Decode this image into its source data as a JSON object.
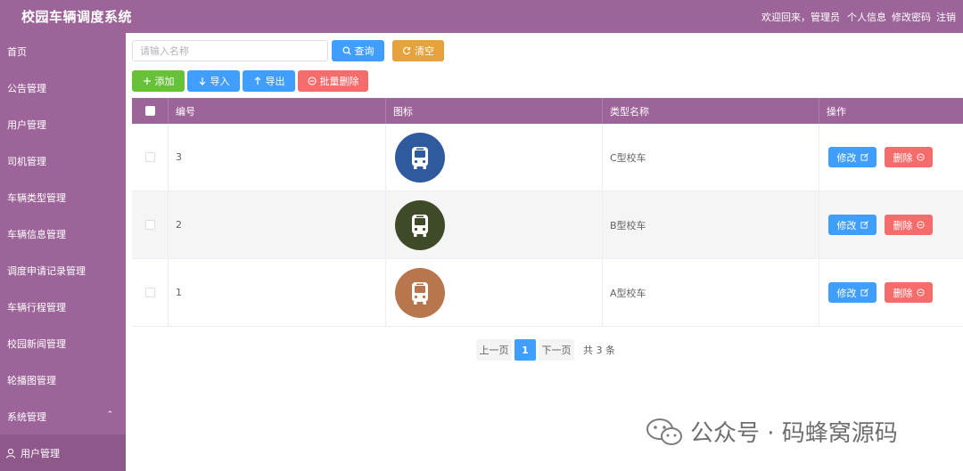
{
  "header": {
    "title": "校园车辆调度系统",
    "welcome": "欢迎回来，管理员",
    "links": [
      "个人信息",
      "修改密码",
      "注销"
    ]
  },
  "sidebar": {
    "items": [
      "首页",
      "公告管理",
      "用户管理",
      "司机管理",
      "车辆类型管理",
      "车辆信息管理",
      "调度申请记录管理",
      "车辆行程管理",
      "校园新闻管理",
      "轮播图管理",
      "系统管理"
    ],
    "system_chevron": "⌃",
    "sub_items": [
      "用户管理"
    ]
  },
  "toolbar": {
    "search_placeholder": "请输入名称",
    "query_label": "查询",
    "clear_label": "清空",
    "add_label": "添加",
    "import_label": "导入",
    "export_label": "导出",
    "bulk_delete_label": "批量删除"
  },
  "table": {
    "headers": [
      "编号",
      "图标",
      "类型名称",
      "操作"
    ],
    "rows": [
      {
        "id": "3",
        "type_name": "C型校车",
        "icon_color": "#2f5a9e",
        "edit": "修改",
        "delete": "删除"
      },
      {
        "id": "2",
        "type_name": "B型校车",
        "icon_color": "#3f4a28",
        "edit": "修改",
        "delete": "删除"
      },
      {
        "id": "1",
        "type_name": "A型校车",
        "icon_color": "#b8764f",
        "edit": "修改",
        "delete": "删除"
      }
    ]
  },
  "pagination": {
    "prev": "上一页",
    "current": "1",
    "next": "下一页",
    "total": "共 3 条"
  },
  "watermark": {
    "text": "公众号 · 码蜂窝源码"
  },
  "colors": {
    "brand": "#9d6499",
    "primary": "#409eff",
    "success": "#67c23a",
    "warning": "#e6a23c",
    "danger": "#f56c6c"
  }
}
